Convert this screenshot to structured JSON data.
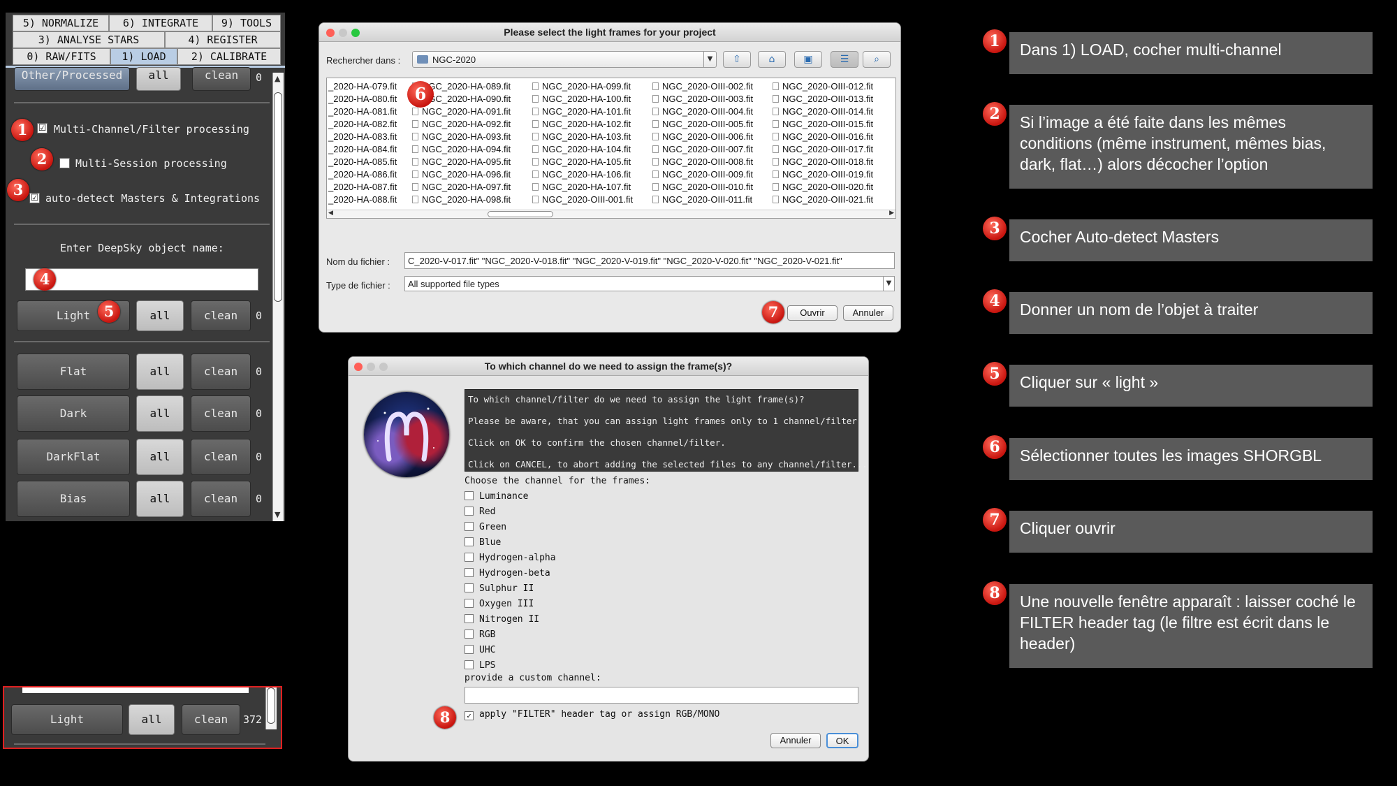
{
  "left_panel": {
    "tabs_row1": [
      "5) NORMALIZE",
      "6) INTEGRATE",
      "9) TOOLS"
    ],
    "tabs_row2": [
      "3) ANALYSE STARS",
      "4) REGISTER"
    ],
    "tabs_row3": [
      "0) RAW/FITS",
      "1) LOAD",
      "2) CALIBRATE"
    ],
    "active_tab": "1) LOAD",
    "other_processed": {
      "label": "Other/Processed",
      "all": "all",
      "clean": "clean",
      "count": "0"
    },
    "multi_channel": {
      "label": "Multi-Channel/Filter processing",
      "checked": true
    },
    "multi_session": {
      "label": "Multi-Session processing",
      "checked": false
    },
    "auto_detect": {
      "label": "auto-detect Masters & Integrations",
      "checked": true
    },
    "object_name_label": "Enter DeepSky object name:",
    "object_name_value": "",
    "frame_rows": [
      {
        "label": "Light",
        "all": "all",
        "clean": "clean",
        "count": "0"
      },
      {
        "label": "Flat",
        "all": "all",
        "clean": "clean",
        "count": "0"
      },
      {
        "label": "Dark",
        "all": "all",
        "clean": "clean",
        "count": "0"
      },
      {
        "label": "DarkFlat",
        "all": "all",
        "clean": "clean",
        "count": "0"
      },
      {
        "label": "Bias",
        "all": "all",
        "clean": "clean",
        "count": "0"
      }
    ],
    "check_glyph": "☑"
  },
  "light_result": {
    "label": "Light",
    "all": "all",
    "clean": "clean",
    "count": "372"
  },
  "file_dialog": {
    "title": "Please select the light frames for your project",
    "look_in_label": "Rechercher dans :",
    "look_in_value": "NGC-2020",
    "columns": [
      [
        "_2020-HA-079.fit",
        "_2020-HA-080.fit",
        "_2020-HA-081.fit",
        "_2020-HA-082.fit",
        "_2020-HA-083.fit",
        "_2020-HA-084.fit",
        "_2020-HA-085.fit",
        "_2020-HA-086.fit",
        "_2020-HA-087.fit",
        "_2020-HA-088.fit"
      ],
      [
        "NGC_2020-HA-089.fit",
        "NGC_2020-HA-090.fit",
        "NGC_2020-HA-091.fit",
        "NGC_2020-HA-092.fit",
        "NGC_2020-HA-093.fit",
        "NGC_2020-HA-094.fit",
        "NGC_2020-HA-095.fit",
        "NGC_2020-HA-096.fit",
        "NGC_2020-HA-097.fit",
        "NGC_2020-HA-098.fit"
      ],
      [
        "NGC_2020-HA-099.fit",
        "NGC_2020-HA-100.fit",
        "NGC_2020-HA-101.fit",
        "NGC_2020-HA-102.fit",
        "NGC_2020-HA-103.fit",
        "NGC_2020-HA-104.fit",
        "NGC_2020-HA-105.fit",
        "NGC_2020-HA-106.fit",
        "NGC_2020-HA-107.fit",
        "NGC_2020-OIII-001.fit"
      ],
      [
        "NGC_2020-OIII-002.fit",
        "NGC_2020-OIII-003.fit",
        "NGC_2020-OIII-004.fit",
        "NGC_2020-OIII-005.fit",
        "NGC_2020-OIII-006.fit",
        "NGC_2020-OIII-007.fit",
        "NGC_2020-OIII-008.fit",
        "NGC_2020-OIII-009.fit",
        "NGC_2020-OIII-010.fit",
        "NGC_2020-OIII-011.fit"
      ],
      [
        "NGC_2020-OIII-012.fit",
        "NGC_2020-OIII-013.fit",
        "NGC_2020-OIII-014.fit",
        "NGC_2020-OIII-015.fit",
        "NGC_2020-OIII-016.fit",
        "NGC_2020-OIII-017.fit",
        "NGC_2020-OIII-018.fit",
        "NGC_2020-OIII-019.fit",
        "NGC_2020-OIII-020.fit",
        "NGC_2020-OIII-021.fit"
      ]
    ],
    "filename_label": "Nom du fichier :",
    "filename_value": "C_2020-V-017.fit\" \"NGC_2020-V-018.fit\" \"NGC_2020-V-019.fit\" \"NGC_2020-V-020.fit\" \"NGC_2020-V-021.fit\"",
    "filetype_label": "Type de fichier :",
    "filetype_value": "All supported file types",
    "open_button": "Ouvrir",
    "cancel_button": "Annuler"
  },
  "channel_dialog": {
    "title": "To which channel do we need to assign the frame(s)?",
    "info_lines": [
      "To which channel/filter do we need to assign the light frame(s)?",
      "Please be aware, that you can assign light frames only to 1 channel/filter",
      "Click on OK to confirm the chosen channel/filter.",
      "Click on CANCEL, to abort adding the selected files to any channel/filter..."
    ],
    "choose_label": "Choose the channel for the frames:",
    "channels": [
      "Luminance",
      "Red",
      "Green",
      "Blue",
      "Hydrogen-alpha",
      "Hydrogen-beta",
      "Sulphur II",
      "Oxygen III",
      "Nitrogen II",
      "RGB",
      "UHC",
      "LPS"
    ],
    "custom_label": "provide a custom channel:",
    "custom_value": "",
    "filter_tag_label": "apply \"FILTER\" header tag or assign RGB/MONO",
    "filter_tag_checked": true,
    "cancel_button": "Annuler",
    "ok_button": "OK"
  },
  "instructions": [
    {
      "num": "1",
      "text": "Dans 1) LOAD, cocher multi-channel"
    },
    {
      "num": "2",
      "text": "Si l’image a été faite dans les mêmes conditions (même instrument, mêmes bias, dark, flat…) alors décocher l’option"
    },
    {
      "num": "3",
      "text": "Cocher Auto-detect Masters"
    },
    {
      "num": "4",
      "text": "Donner un nom de l’objet à traiter"
    },
    {
      "num": "5",
      "text": "Cliquer sur « light »"
    },
    {
      "num": "6",
      "text": "Sélectionner toutes les images SHORGBL"
    },
    {
      "num": "7",
      "text": "Cliquer ouvrir"
    },
    {
      "num": "8",
      "text": "Une nouvelle fenêtre apparaît : laisser coché le FILTER header tag (le filtre est écrit dans le header)"
    }
  ],
  "colors": {
    "badge": "#d0201a",
    "instruction_bg": "#5a5a5a",
    "panel_bg": "#3a3a3a",
    "active_tab": "#b9cde4"
  }
}
